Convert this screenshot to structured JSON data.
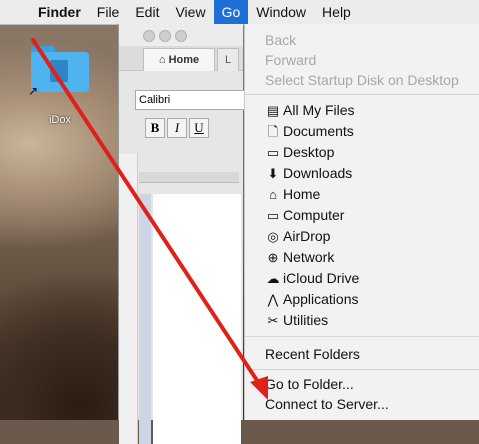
{
  "menubar": {
    "app_name": "Finder",
    "items": [
      "File",
      "Edit",
      "View",
      "Go",
      "Window",
      "Help"
    ],
    "active": "Go"
  },
  "desktop_icon": {
    "label": "iDox"
  },
  "word_window": {
    "tab_home": "Home",
    "tab_next": "L",
    "font_name": "Calibri",
    "bold": "B",
    "italic": "I",
    "underline": "U"
  },
  "go_menu": {
    "disabled_items": [
      "Back",
      "Forward",
      "Select Startup Disk on Desktop"
    ],
    "places": [
      {
        "label": "All My Files",
        "icon": "all-files-icon",
        "glyph": "▤"
      },
      {
        "label": "Documents",
        "icon": "documents-icon",
        "glyph": "🗋"
      },
      {
        "label": "Desktop",
        "icon": "desktop-icon",
        "glyph": "▭"
      },
      {
        "label": "Downloads",
        "icon": "downloads-icon",
        "glyph": "⬇"
      },
      {
        "label": "Home",
        "icon": "home-icon",
        "glyph": "⌂"
      },
      {
        "label": "Computer",
        "icon": "computer-icon",
        "glyph": "▭"
      },
      {
        "label": "AirDrop",
        "icon": "airdrop-icon",
        "glyph": "◎"
      },
      {
        "label": "Network",
        "icon": "network-icon",
        "glyph": "⊕"
      },
      {
        "label": "iCloud Drive",
        "icon": "icloud-icon",
        "glyph": "☁"
      },
      {
        "label": "Applications",
        "icon": "applications-icon",
        "glyph": "⋀"
      },
      {
        "label": "Utilities",
        "icon": "utilities-icon",
        "glyph": "✂"
      }
    ],
    "recent_folders": "Recent Folders",
    "go_to_folder": "Go to Folder...",
    "connect_to_server": "Connect to Server..."
  },
  "annotation_color": "#e0201a"
}
